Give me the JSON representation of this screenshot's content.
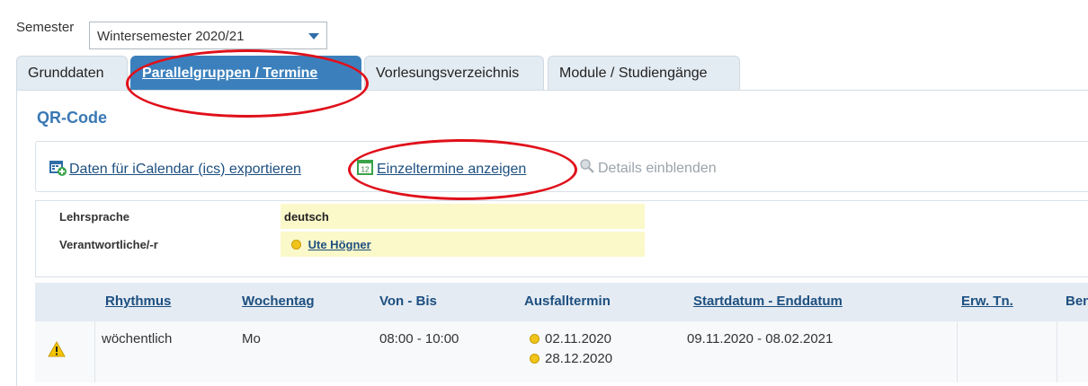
{
  "semester": {
    "label": "Semester",
    "selected": "Wintersemester 2020/21"
  },
  "tabs": [
    {
      "label": "Grunddaten"
    },
    {
      "label": "Parallelgruppen / Termine"
    },
    {
      "label": "Vorlesungsverzeichnis"
    },
    {
      "label": "Module / Studiengänge"
    }
  ],
  "section": {
    "title": "QR-Code"
  },
  "actions": {
    "export_ics": "Daten für iCalendar (ics) exportieren",
    "single_dates": "Einzeltermine anzeigen",
    "details": "Details einblenden",
    "icons": [
      "calendar-export-icon",
      "calendar-day-icon",
      "magnifier-icon"
    ]
  },
  "info": {
    "language_label": "Lehrsprache",
    "language_value": "deutsch",
    "responsible_label": "Verantwortliche/-r",
    "responsible_value": "Ute Högner"
  },
  "table": {
    "headers": [
      "Rhythmus",
      "Wochentag",
      "Von - Bis",
      "Ausfalltermin",
      "Startdatum - Enddatum",
      "Erw. Tn.",
      "Ben"
    ],
    "row": {
      "rhythm": "wöchentlich",
      "weekday": "Mo",
      "time": "08:00 - 10:00",
      "cancel_dates": [
        "02.11.2020",
        "28.12.2020"
      ],
      "date_range": "09.11.2020 - 08.02.2021"
    }
  },
  "colors": {
    "accent": "#3b80bd",
    "annotation": "#e0101a",
    "highlight": "#fbf8c9",
    "warning": "#f5c400"
  }
}
